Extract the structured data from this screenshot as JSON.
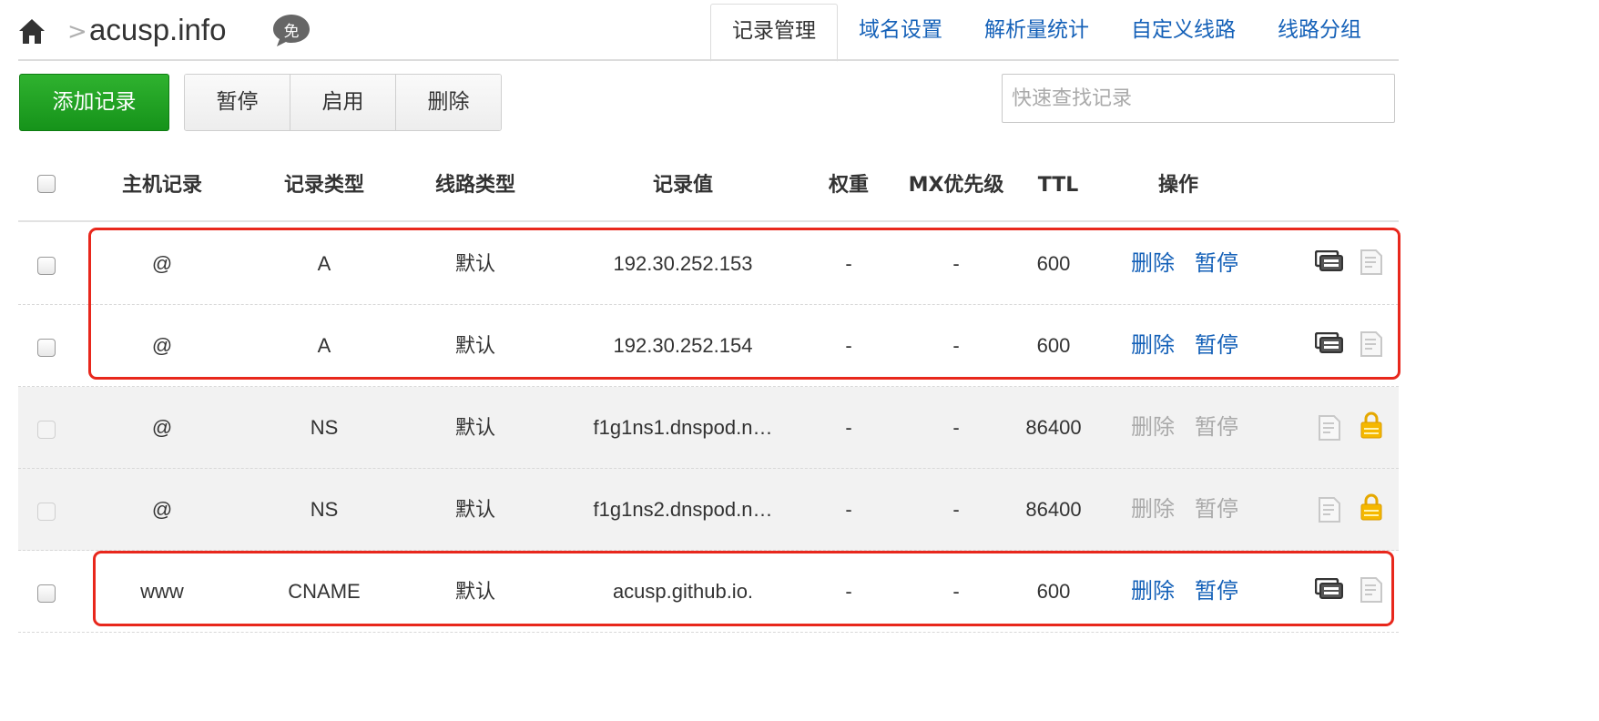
{
  "breadcrumb": {
    "separator": ">",
    "domain": "acusp.info",
    "badge_text": "免"
  },
  "tabs": [
    "记录管理",
    "域名设置",
    "解析量统计",
    "自定义线路",
    "线路分组"
  ],
  "toolbar": {
    "add_label": "添加记录",
    "pause_label": "暂停",
    "enable_label": "启用",
    "delete_label": "删除"
  },
  "search": {
    "placeholder": "快速查找记录",
    "value": ""
  },
  "table": {
    "headers": {
      "host": "主机记录",
      "type": "记录类型",
      "line": "线路类型",
      "value": "记录值",
      "weight": "权重",
      "mx": "MX优先级",
      "ttl": "TTL",
      "ops": "操作"
    },
    "rows": [
      {
        "host": "@",
        "type": "A",
        "line": "默认",
        "value": "192.30.252.153",
        "weight": "-",
        "mx": "-",
        "ttl": "600",
        "delete": "删除",
        "pause": "暂停",
        "locked": false
      },
      {
        "host": "@",
        "type": "A",
        "line": "默认",
        "value": "192.30.252.154",
        "weight": "-",
        "mx": "-",
        "ttl": "600",
        "delete": "删除",
        "pause": "暂停",
        "locked": false
      },
      {
        "host": "@",
        "type": "NS",
        "line": "默认",
        "value": "f1g1ns1.dnspod.n…",
        "weight": "-",
        "mx": "-",
        "ttl": "86400",
        "delete": "删除",
        "pause": "暂停",
        "locked": true
      },
      {
        "host": "@",
        "type": "NS",
        "line": "默认",
        "value": "f1g1ns2.dnspod.n…",
        "weight": "-",
        "mx": "-",
        "ttl": "86400",
        "delete": "删除",
        "pause": "暂停",
        "locked": true
      },
      {
        "host": "www",
        "type": "CNAME",
        "line": "默认",
        "value": "acusp.github.io.",
        "weight": "-",
        "mx": "-",
        "ttl": "600",
        "delete": "删除",
        "pause": "暂停",
        "locked": false
      }
    ]
  },
  "icons": {
    "home": "home-icon",
    "free_badge": "free-badge-icon",
    "remark": "remark-icon",
    "note": "note-icon",
    "lock": "lock-icon"
  },
  "colors": {
    "link": "#1561b8",
    "add_button": "#1a9a1e",
    "highlight": "#e8271c",
    "lock": "#f5b800",
    "disabled": "#aaaaaa"
  }
}
